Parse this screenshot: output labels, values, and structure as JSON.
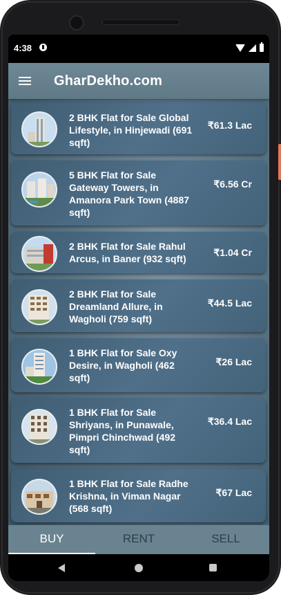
{
  "status_bar": {
    "time": "4:38",
    "icons": [
      "app-notification-icon",
      "wifi-icon",
      "signal-icon",
      "battery-icon"
    ]
  },
  "app_bar": {
    "menu_icon": "hamburger-menu-icon",
    "title": "GharDekho.com"
  },
  "listings": [
    {
      "title": "2 BHK Flat for Sale Global Lifestyle, in Hinjewadi (691 sqft)",
      "price": "₹61.3 Lac"
    },
    {
      "title": "5 BHK Flat for Sale Gateway Towers, in Amanora Park Town (4887 sqft)",
      "price": "₹6.56 Cr"
    },
    {
      "title": "2 BHK Flat for Sale Rahul Arcus, in Baner (932 sqft)",
      "price": "₹1.04 Cr"
    },
    {
      "title": "2 BHK Flat for Sale Dreamland Allure, in Wagholi (759 sqft)",
      "price": "₹44.5 Lac"
    },
    {
      "title": "1 BHK Flat for Sale Oxy Desire, in Wagholi (462 sqft)",
      "price": "₹26 Lac"
    },
    {
      "title": "1 BHK Flat for Sale Shriyans, in Punawale, Pimpri Chinchwad (492 sqft)",
      "price": "₹36.4 Lac"
    },
    {
      "title": "1 BHK Flat for Sale Radhe Krishna, in Viman Nagar (568 sqft)",
      "price": "₹67 Lac"
    }
  ],
  "tabs": [
    {
      "label": "BUY",
      "active": true
    },
    {
      "label": "RENT",
      "active": false
    },
    {
      "label": "SELL",
      "active": false
    }
  ],
  "nav_bar": {
    "icons": [
      "back-icon",
      "home-icon",
      "recent-apps-icon"
    ]
  },
  "colors": {
    "app_bar": "#6e8896",
    "card": "#4a6a82",
    "tab_bar": "#6a8391",
    "active_tab": "#ffffff"
  }
}
